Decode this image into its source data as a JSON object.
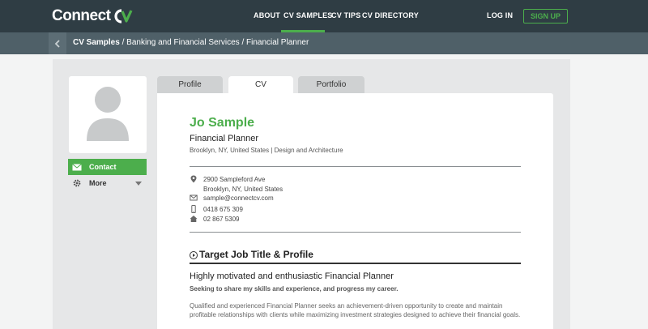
{
  "brand": {
    "name": "Connect",
    "accent_color": "#4cae4c",
    "nav_bg": "#2f3d44",
    "crumb_bg": "#4f6068"
  },
  "nav": {
    "items": [
      {
        "label": "ABOUT"
      },
      {
        "label": "CV SAMPLES",
        "active": true
      },
      {
        "label": "CV TIPS"
      },
      {
        "label": "CV DIRECTORY"
      }
    ],
    "login_label": "LOG IN",
    "signup_label": "SIGN UP"
  },
  "breadcrumb": {
    "root": "CV Samples",
    "rest": " / Banking and Financial Services / Financial Planner"
  },
  "sidebar": {
    "avatar_icon": "user-silhouette-icon",
    "contact_label": "Contact",
    "contact_icon": "envelope-icon",
    "more_label": "More",
    "more_icon": "gear-icon"
  },
  "tabs": [
    {
      "label": "Profile",
      "active": false
    },
    {
      "label": "CV",
      "active": true
    },
    {
      "label": "Portfolio",
      "active": false
    }
  ],
  "cv": {
    "name": "Jo Sample",
    "title": "Financial Planner",
    "location_line": "Brooklyn, NY, United States | Design and Architecture",
    "address_line1": "2900 Sampleford Ave",
    "address_line2": "Brooklyn, NY, United States",
    "email": "sample@connectcv.com",
    "mobile": "0418 675 309",
    "phone": "02 867 5309",
    "section_title": "Target Job Title & Profile",
    "headline": "Highly motivated and enthusiastic Financial Planner",
    "subhead": "Seeking to share my skills and experience, and progress my career.",
    "summary": "Qualified and experienced Financial Planner seeks an achievement-driven opportunity to create and maintain profitable relationships with clients while maximizing investment strategies designed to achieve their financial goals."
  }
}
